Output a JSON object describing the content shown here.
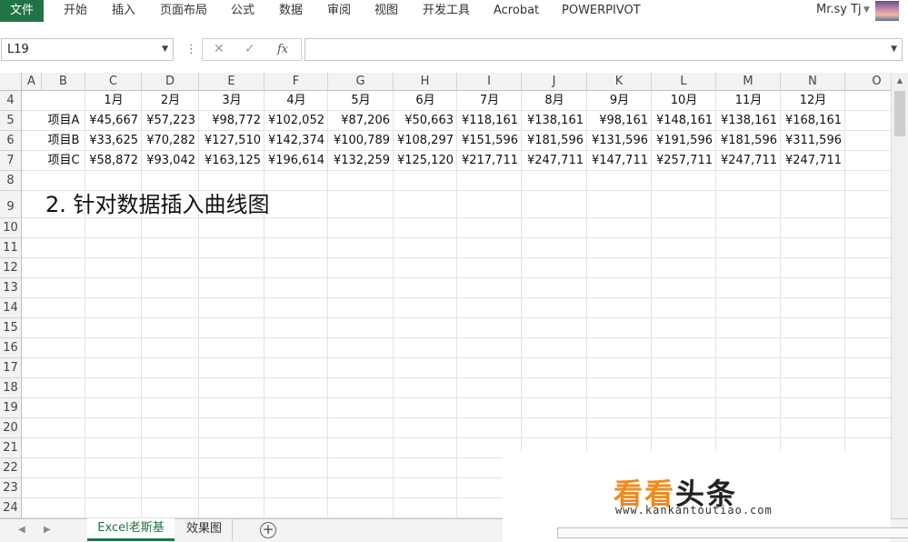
{
  "ribbon": {
    "file_tab": "文件",
    "tabs": [
      "开始",
      "插入",
      "页面布局",
      "公式",
      "数据",
      "审阅",
      "视图",
      "开发工具",
      "Acrobat",
      "POWERPIVOT"
    ],
    "user_name": "Mr.sy Tj"
  },
  "formula_bar": {
    "name_box": "L19",
    "formula": "",
    "fx_label": "fx"
  },
  "grid": {
    "columns": [
      "A",
      "B",
      "C",
      "D",
      "E",
      "F",
      "G",
      "H",
      "I",
      "J",
      "K",
      "L",
      "M",
      "N",
      "O"
    ],
    "rows": [
      "4",
      "5",
      "6",
      "7",
      "8",
      "9",
      "10",
      "11",
      "12",
      "13",
      "14",
      "15",
      "16",
      "17",
      "18",
      "19",
      "20",
      "21",
      "22",
      "23",
      "24"
    ],
    "months": [
      "1月",
      "2月",
      "3月",
      "4月",
      "5月",
      "6月",
      "7月",
      "8月",
      "9月",
      "10月",
      "11月",
      "12月"
    ],
    "data_rows": [
      {
        "label": "项目A",
        "values": [
          "¥45,667",
          "¥57,223",
          "¥98,772",
          "¥102,052",
          "¥87,206",
          "¥50,663",
          "¥118,161",
          "¥138,161",
          "¥98,161",
          "¥148,161",
          "¥138,161",
          "¥168,161"
        ]
      },
      {
        "label": "项目B",
        "values": [
          "¥33,625",
          "¥70,282",
          "¥127,510",
          "¥142,374",
          "¥100,789",
          "¥108,297",
          "¥151,596",
          "¥181,596",
          "¥131,596",
          "¥191,596",
          "¥181,596",
          "¥311,596"
        ]
      },
      {
        "label": "项目C",
        "values": [
          "¥58,872",
          "¥93,042",
          "¥163,125",
          "¥196,614",
          "¥132,259",
          "¥125,120",
          "¥217,711",
          "¥247,711",
          "¥147,711",
          "¥257,711",
          "¥247,711",
          "¥247,711"
        ]
      }
    ],
    "note": "2. 针对数据插入曲线图"
  },
  "sheets": {
    "tabs": [
      "Excel老斯基",
      "效果图"
    ],
    "active": "Excel老斯基"
  },
  "watermark": {
    "orange_text": "看看",
    "dark_text": "头条",
    "url": "www.kankantoutiao.com"
  }
}
